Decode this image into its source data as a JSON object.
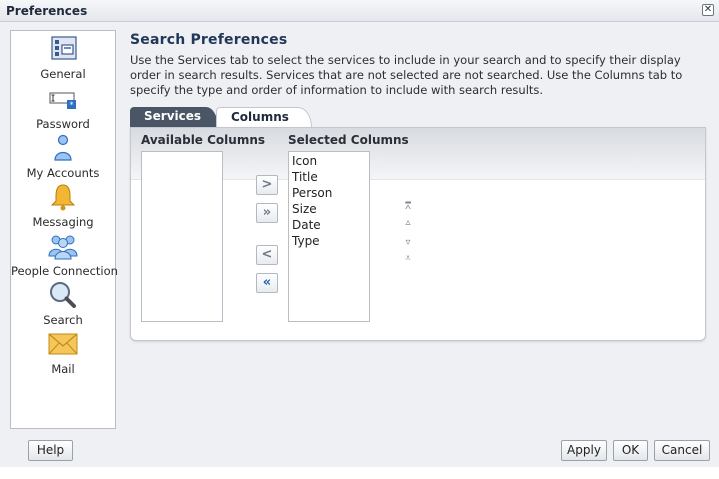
{
  "window": {
    "title": "Preferences"
  },
  "sidebar": {
    "items": [
      {
        "label": "General",
        "icon": "general-settings-icon"
      },
      {
        "label": "Password",
        "icon": "password-icon"
      },
      {
        "label": "My Accounts",
        "icon": "user-account-icon"
      },
      {
        "label": "Messaging",
        "icon": "bell-icon"
      },
      {
        "label": "People Connection",
        "icon": "people-icon"
      },
      {
        "label": "Search",
        "icon": "magnifier-icon"
      },
      {
        "label": "Mail",
        "icon": "envelope-icon"
      }
    ]
  },
  "main": {
    "heading": "Search Preferences",
    "description": "Use the Services tab to select the services to include in your search and to specify their display order in search results. Services that are not selected are not searched. Use the Columns tab to specify the type and order of information to include with search results.",
    "tabs": [
      {
        "label": "Services",
        "selected": false
      },
      {
        "label": "Columns",
        "selected": true
      }
    ],
    "available_header": "Available Columns",
    "selected_header": "Selected Columns",
    "available_columns": [],
    "selected_columns": [
      "Icon",
      "Title",
      "Person",
      "Size",
      "Date",
      "Type"
    ],
    "shuttle": {
      "move": ">",
      "move_all": "»",
      "remove": "<",
      "remove_all": "«"
    },
    "order": {
      "top": "⩞",
      "up": "▵",
      "down": "▿",
      "bottom": "⩡"
    }
  },
  "footer": {
    "help": "Help",
    "apply": "Apply",
    "ok": "OK",
    "cancel": "Cancel"
  },
  "colors": {
    "heading": "#22385a",
    "tab_inactive": "#4a5565",
    "accent": "#2160b8"
  }
}
